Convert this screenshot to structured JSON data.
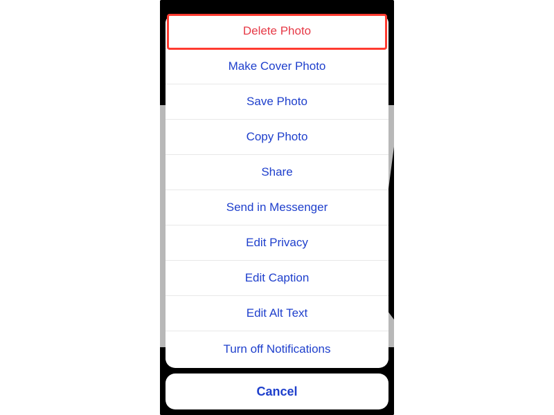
{
  "actionSheet": {
    "options": [
      {
        "label": "Delete Photo",
        "destructive": true,
        "name": "delete-photo-option"
      },
      {
        "label": "Make Cover Photo",
        "destructive": false,
        "name": "make-cover-photo-option"
      },
      {
        "label": "Save Photo",
        "destructive": false,
        "name": "save-photo-option"
      },
      {
        "label": "Copy Photo",
        "destructive": false,
        "name": "copy-photo-option"
      },
      {
        "label": "Share",
        "destructive": false,
        "name": "share-option"
      },
      {
        "label": "Send in Messenger",
        "destructive": false,
        "name": "send-messenger-option"
      },
      {
        "label": "Edit Privacy",
        "destructive": false,
        "name": "edit-privacy-option"
      },
      {
        "label": "Edit Caption",
        "destructive": false,
        "name": "edit-caption-option"
      },
      {
        "label": "Edit Alt Text",
        "destructive": false,
        "name": "edit-alt-text-option"
      },
      {
        "label": "Turn off Notifications",
        "destructive": false,
        "name": "turn-off-notifications-option"
      }
    ],
    "cancel_label": "Cancel"
  },
  "highlight": {
    "target_index": 0
  },
  "colors": {
    "primary_action": "#1e3fcc",
    "destructive": "#e63946",
    "highlight_border": "#ff3b30"
  }
}
